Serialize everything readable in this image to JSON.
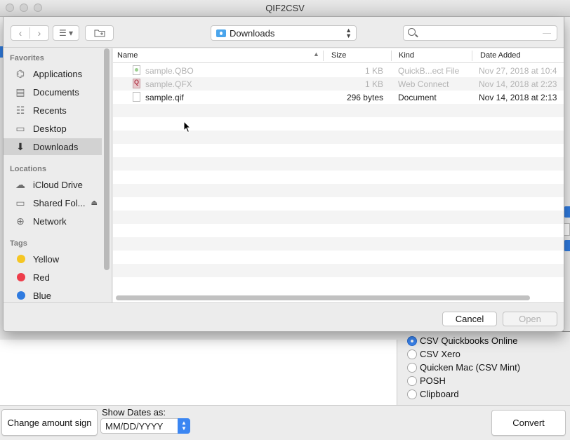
{
  "app": {
    "title": "QIF2CSV"
  },
  "output_options": [
    {
      "label": "CSV Quickbooks Online",
      "checked": true
    },
    {
      "label": "CSV Xero",
      "checked": false
    },
    {
      "label": "Quicken Mac (CSV Mint)",
      "checked": false
    },
    {
      "label": "POSH",
      "checked": false
    },
    {
      "label": "Clipboard",
      "checked": false
    }
  ],
  "bottom": {
    "change_amount_sign": "Change amount sign",
    "show_dates_label": "Show Dates as:",
    "date_format": "MM/DD/YYYY",
    "convert": "Convert"
  },
  "dialog": {
    "location": "Downloads",
    "search_placeholder": "",
    "sidebar": {
      "favorites_header": "Favorites",
      "favorites": [
        {
          "label": "Applications",
          "icon": "applications-icon"
        },
        {
          "label": "Documents",
          "icon": "documents-icon"
        },
        {
          "label": "Recents",
          "icon": "recents-icon"
        },
        {
          "label": "Desktop",
          "icon": "desktop-icon"
        },
        {
          "label": "Downloads",
          "icon": "downloads-icon",
          "selected": true
        }
      ],
      "locations_header": "Locations",
      "locations": [
        {
          "label": "iCloud Drive",
          "icon": "cloud-icon"
        },
        {
          "label": "Shared Fol...",
          "icon": "display-icon"
        },
        {
          "label": "Network",
          "icon": "globe-icon"
        }
      ],
      "tags_header": "Tags",
      "tags": [
        {
          "label": "Yellow",
          "color": "#f5c623"
        },
        {
          "label": "Red",
          "color": "#ee3d4b"
        },
        {
          "label": "Blue",
          "color": "#2f7be0"
        }
      ]
    },
    "columns": {
      "name": "Name",
      "size": "Size",
      "kind": "Kind",
      "date_added": "Date Added"
    },
    "files": [
      {
        "name": "sample.QBO",
        "size": "1 KB",
        "kind": "QuickB...ect File",
        "date": "Nov 27, 2018 at 10:4",
        "enabled": false,
        "type": "qbo"
      },
      {
        "name": "sample.QFX",
        "size": "1 KB",
        "kind": "Web Connect",
        "date": "Nov 14, 2018 at 2:23",
        "enabled": false,
        "type": "qfx"
      },
      {
        "name": "sample.qif",
        "size": "296 bytes",
        "kind": "Document",
        "date": "Nov 14, 2018 at 2:13",
        "enabled": true,
        "type": "doc"
      }
    ],
    "cancel": "Cancel",
    "open": "Open"
  }
}
